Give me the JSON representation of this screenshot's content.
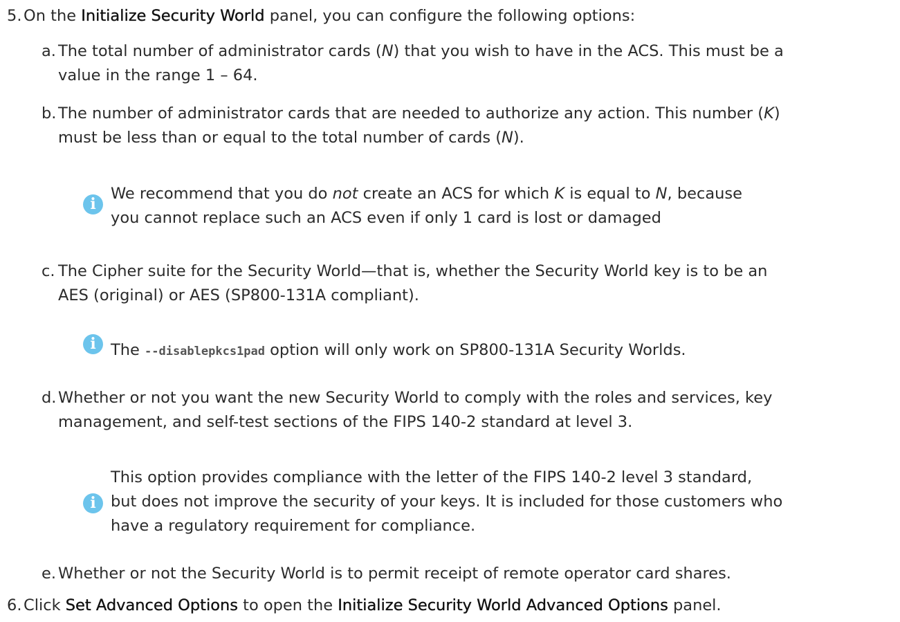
{
  "step5": {
    "number": "5.",
    "intro_before": "On the ",
    "panel_name": "Initialize Security World",
    "intro_after": " panel, you can configure the following options:",
    "items": {
      "a": {
        "letter": "a.",
        "line1_before": "The total number of administrator cards (",
        "line1_var": "N",
        "line1_after": ") that you wish to have in the ACS. This must be a",
        "line2": "value in the range 1 – 64."
      },
      "b": {
        "letter": "b.",
        "line1_before": "The number of administrator cards that are needed to authorize any action. This number (",
        "line1_var": "K",
        "line1_after": ")",
        "line2_before": "must be less than or equal to the total number of cards (",
        "line2_var": "N",
        "line2_after": ")."
      },
      "note1": {
        "icon": "info-icon",
        "line1_before": "We recommend that you do ",
        "line1_em": "not",
        "line1_mid": " create an ACS for which ",
        "line1_k": "K",
        "line1_mid2": " is equal to ",
        "line1_n": "N",
        "line1_after": ", because",
        "line2": "you cannot replace such an ACS even if only 1 card is lost or damaged"
      },
      "c": {
        "letter": "c.",
        "line1": "The Cipher suite for the Security World—that is, whether the Security World key is to be an",
        "line2": "AES (original) or AES (SP800-131A compliant)."
      },
      "note2": {
        "icon": "info-icon",
        "before": "The ",
        "code": "--disablepkcs1pad",
        "after": " option will only work on SP800-131A Security Worlds."
      },
      "d": {
        "letter": "d.",
        "line1": "Whether or not you want the new Security World to comply with the roles and services, key",
        "line2": "management, and self-test sections of the FIPS 140-2 standard at level 3."
      },
      "note3": {
        "icon": "info-icon",
        "line1": "This option provides compliance with the letter of the FIPS 140-2 level 3 standard,",
        "line2": "but does not improve the security of your keys. It is included for those customers who",
        "line3": "have a regulatory requirement for compliance."
      },
      "e": {
        "letter": "e.",
        "line1": "Whether or not the Security World is to permit receipt of remote operator card shares."
      }
    }
  },
  "step6": {
    "number": "6.",
    "before": "Click ",
    "button_name": "Set Advanced Options",
    "middle": " to open the ",
    "panel_name": "Initialize Security World Advanced Options",
    "after": " panel."
  },
  "colors": {
    "info_icon": "#6cc4ec",
    "text": "#2b2b2b"
  }
}
